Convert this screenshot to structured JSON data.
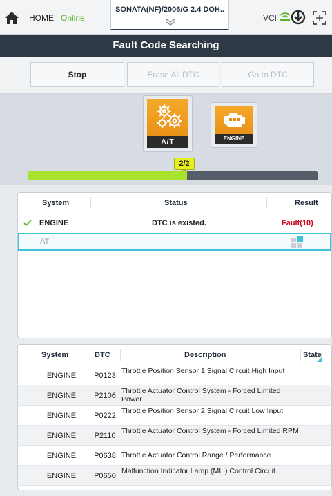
{
  "topbar": {
    "home_label": "HOME",
    "status_label": "Online",
    "vehicle": "SONATA(NF)/2006/G 2.4 DOH..",
    "vci_label": "VCI"
  },
  "title": "Fault Code Searching",
  "buttons": {
    "stop": "Stop",
    "erase": "Erase All DTC",
    "goto": "Go to DTC"
  },
  "modules": [
    {
      "label": "A/T",
      "icon": "gears-icon"
    },
    {
      "label": "ENGINE",
      "icon": "engine-icon"
    }
  ],
  "progress": {
    "text": "2/2",
    "fraction": 0.55
  },
  "status_table": {
    "headers": {
      "system": "System",
      "status": "Status",
      "result": "Result"
    },
    "rows": [
      {
        "system": "ENGINE",
        "status": "DTC is existed.",
        "result": "Fault(10)"
      },
      {
        "system": "AT",
        "status": "",
        "result": ""
      }
    ]
  },
  "dtc_table": {
    "headers": {
      "system": "System",
      "dtc": "DTC",
      "description": "Description",
      "state": "State"
    },
    "rows": [
      {
        "system": "ENGINE",
        "dtc": "P0123",
        "description": "Throttle Position Sensor 1 Signal Circuit High Input"
      },
      {
        "system": "ENGINE",
        "dtc": "P2106",
        "description": "Throttle Actuator Control System - Forced Limited Power"
      },
      {
        "system": "ENGINE",
        "dtc": "P0222",
        "description": "Throttle Position Sensor 2 Signal Circuit Low Input"
      },
      {
        "system": "ENGINE",
        "dtc": "P2110",
        "description": "Throttle Actuator Control System - Forced Limited RPM"
      },
      {
        "system": "ENGINE",
        "dtc": "P0638",
        "description": "Throttle Actuator Control Range / Performance"
      },
      {
        "system": "ENGINE",
        "dtc": "P0650",
        "description": "Malfunction Indicator Lamp (MIL) Control Circuit"
      }
    ]
  },
  "colors": {
    "accent": "#3ec2d8",
    "online": "#58b52a",
    "fault": "#d0021b",
    "progress": "#a8e22c",
    "module": "#f4a92a"
  }
}
